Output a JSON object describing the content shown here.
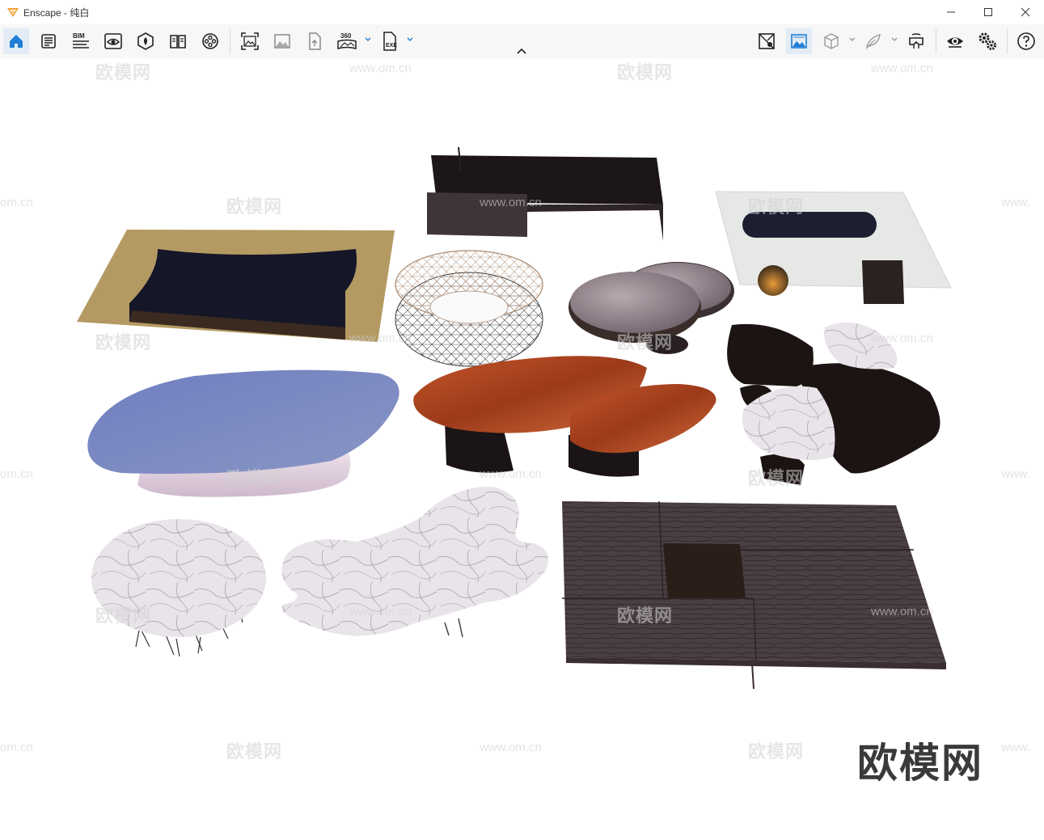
{
  "window": {
    "app_name": "Enscape",
    "separator": " - ",
    "mode": "纯白",
    "accent": "#f0a030"
  },
  "toolbar": {
    "left_tools": [
      {
        "name": "home",
        "icon": "home-icon",
        "active": true
      },
      {
        "name": "project-info",
        "icon": "list-document-icon"
      },
      {
        "name": "bim",
        "icon": "bim-icon",
        "label": "BIM"
      },
      {
        "name": "view-management",
        "icon": "eye-frame-icon"
      },
      {
        "name": "asset-library",
        "icon": "leaf-icon"
      },
      {
        "name": "material-editor",
        "icon": "book-icon"
      },
      {
        "name": "video-editor",
        "icon": "film-reel-icon"
      },
      {
        "name": "screenshot",
        "icon": "capture-image-icon"
      },
      {
        "name": "batch-render",
        "icon": "gallery-icon"
      },
      {
        "name": "export-upload",
        "icon": "upload-file-icon"
      },
      {
        "name": "panorama",
        "icon": "panorama-360-icon",
        "label": "360"
      },
      {
        "name": "exe-export",
        "icon": "exe-file-icon",
        "label": "EXE"
      }
    ],
    "right_tools": [
      {
        "name": "capture-settings",
        "icon": "map-pin-icon"
      },
      {
        "name": "visual-settings",
        "icon": "image-frame-icon",
        "active": true
      },
      {
        "name": "section",
        "icon": "cube-icon"
      },
      {
        "name": "feedback",
        "icon": "feather-icon"
      },
      {
        "name": "vr-headset",
        "icon": "vr-headset-icon"
      },
      {
        "name": "view-toggle",
        "icon": "eye-icon"
      },
      {
        "name": "settings",
        "icon": "gears-icon"
      },
      {
        "name": "help",
        "icon": "help-icon"
      }
    ]
  },
  "watermarks": {
    "site_cn": "欧模网",
    "site_url": "www.om.cn",
    "site_url_partial": "om.cn",
    "site_url_prefix": "www."
  }
}
